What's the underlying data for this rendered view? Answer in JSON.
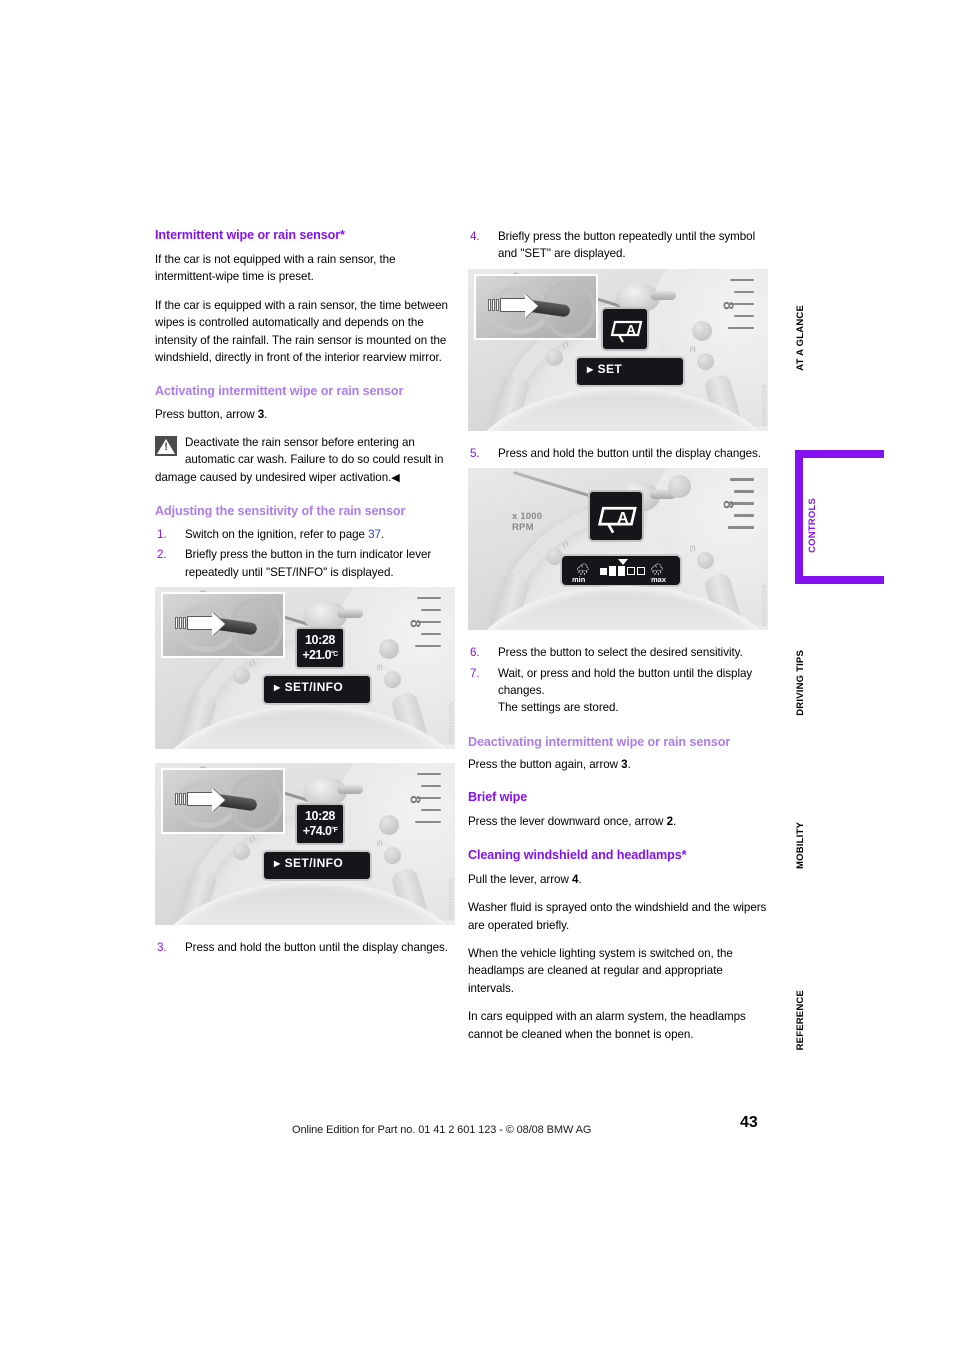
{
  "colors": {
    "heading_primary": "#8412f0",
    "heading_secondary": "#ad7ded",
    "xref_link": "#2b3af0",
    "rail_active": "#8412f0"
  },
  "left_column": {
    "heading": "Intermittent wipe or rain sensor*",
    "para1": "If the car is not equipped with a rain sensor, the intermittent-wipe time is preset.",
    "para2": "If the car is equipped with a rain sensor, the time between wipes is controlled automatically and depends on the intensity of the rainfall. The rain sensor is mounted on the windshield, directly in front of the interior rearview mirror.",
    "subheading_activating": "Activating intermittent wipe or rain sensor",
    "activating_text_pre": "Press button, arrow ",
    "activating_arrow": "3",
    "activating_text_post": ".",
    "warning_text": "Deactivate the rain sensor before entering an automatic car wash. Failure to do so could result in damage caused by undesired wiper activation.",
    "warning_end_marker": "◀",
    "subheading_adjusting": "Adjusting the sensitivity of the rain sensor",
    "steps": [
      {
        "num": "1.",
        "text_pre": "Switch on the ignition, refer to page ",
        "xref": "37",
        "text_post": "."
      },
      {
        "num": "2.",
        "text_pre": "Briefly press the button in the turn indicator lever repeatedly until \"SET/INFO\" is displayed.",
        "xref": "",
        "text_post": ""
      },
      {
        "num": "3.",
        "text_pre": "Press and hold the button until the display changes.",
        "xref": "",
        "text_post": ""
      }
    ],
    "figure_celsius": {
      "time": "10:28",
      "temperature": "+21.0",
      "unit": "°C",
      "display_bar": "SET/INFO",
      "rpm_label": "",
      "code": "WCCD71USCS"
    },
    "figure_fahrenheit": {
      "time": "10:28",
      "temperature": "+74.0",
      "unit": "°F",
      "display_bar": "SET/INFO",
      "rpm_label": "",
      "code": "WCCD71USCS"
    }
  },
  "right_column": {
    "steps_upper": [
      {
        "num": "4.",
        "text": "Briefly press the button repeatedly until the symbol and \"SET\" are displayed."
      }
    ],
    "figure_set": {
      "symbol": "wiper-auto",
      "symbol_letter": "A",
      "display_bar": "SET",
      "code": "WCCD71USCS"
    },
    "steps_mid": [
      {
        "num": "5.",
        "text": "Press and hold the button until the display changes."
      }
    ],
    "figure_sensitivity": {
      "symbol": "wiper-auto",
      "symbol_letter": "A",
      "rpm_label_line1": "x 1000",
      "rpm_label_line2": "RPM",
      "scale_min": "min",
      "scale_max": "max",
      "code": "WCCD71USCS"
    },
    "steps_lower": [
      {
        "num": "6.",
        "text": "Press the button to select the desired sensitivity.",
        "extra": ""
      },
      {
        "num": "7.",
        "text": "Wait, or press and hold the button until the display changes.",
        "extra": "The settings are stored."
      }
    ],
    "subheading_deactivating": "Deactivating intermittent wipe or rain sensor",
    "deactivating_text_pre": "Press the button again, arrow ",
    "deactivating_arrow": "3",
    "deactivating_text_post": ".",
    "heading_brief_wipe": "Brief wipe",
    "brief_wipe_text_pre": "Press the lever downward once, arrow ",
    "brief_wipe_arrow": "2",
    "brief_wipe_text_post": ".",
    "heading_cleaning": "Cleaning windshield and headlamps*",
    "cleaning_text_pre": "Pull the lever, arrow ",
    "cleaning_arrow": "4",
    "cleaning_text_post": ".",
    "cleaning_para1": "Washer fluid is sprayed onto the windshield and the wipers are operated briefly.",
    "cleaning_para2": "When the vehicle lighting system is switched on, the headlamps are cleaned at regular and appropriate intervals.",
    "cleaning_para3": "In cars equipped with an alarm system, the headlamps cannot be cleaned when the bonnet is open."
  },
  "side_rail": {
    "items": [
      {
        "label": "AT A GLANCE",
        "active": false
      },
      {
        "label": "CONTROLS",
        "active": true
      },
      {
        "label": "DRIVING TIPS",
        "active": false
      },
      {
        "label": "MOBILITY",
        "active": false
      },
      {
        "label": "REFERENCE",
        "active": false
      }
    ]
  },
  "footer": {
    "text": "Online Edition for Part no. 01 41 2 601 123  - © 08/08 BMW AG",
    "page_number": "43"
  }
}
